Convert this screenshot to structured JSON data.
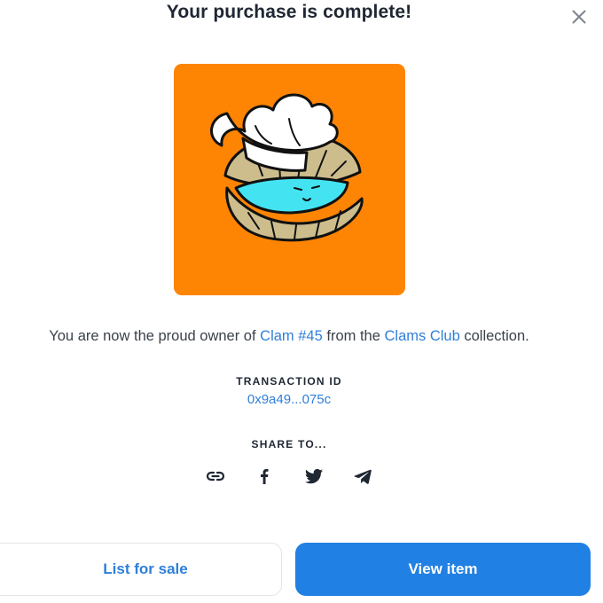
{
  "modal": {
    "title": "Your purchase is complete!",
    "close_icon": "close-icon"
  },
  "artwork": {
    "background_color": "#fe8404",
    "subject": "clam-with-chef-hat"
  },
  "ownership": {
    "prefix": "You are now the proud owner of ",
    "item_name": "Clam #45",
    "middle": " from the ",
    "collection_name": "Clams Club",
    "suffix": " collection."
  },
  "transaction": {
    "label": "TRANSACTION ID",
    "id": "0x9a49...075c"
  },
  "share": {
    "label": "SHARE TO...",
    "icons": [
      "link-icon",
      "facebook-icon",
      "twitter-icon",
      "telegram-icon"
    ]
  },
  "actions": {
    "list_for_sale": "List for sale",
    "view_item": "View item"
  },
  "colors": {
    "accent": "#2180e3",
    "link": "#2e7fd9",
    "title": "#1f2733"
  }
}
